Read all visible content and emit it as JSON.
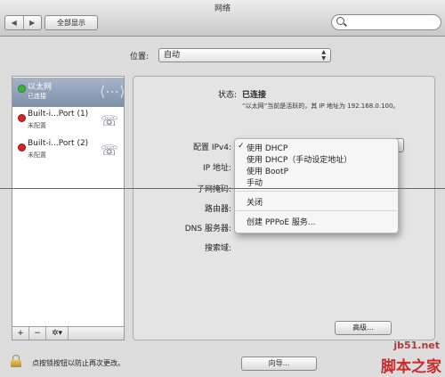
{
  "window": {
    "title": "网络"
  },
  "toolbar": {
    "back": "◀",
    "forward": "▶",
    "show_all": "全部显示",
    "search_placeholder": ""
  },
  "location": {
    "label": "位置:",
    "value": "自动"
  },
  "services": [
    {
      "name": "以太网",
      "status": "已连接",
      "status_color": "green",
      "icon": "ethernet-icon",
      "selected": true
    },
    {
      "name": "Built-i...Port (1)",
      "status": "未配置",
      "status_color": "red",
      "icon": "phone-icon",
      "selected": false
    },
    {
      "name": "Built-i...Port (2)",
      "status": "未配置",
      "status_color": "red",
      "icon": "phone-icon",
      "selected": false
    }
  ],
  "sidebar_buttons": {
    "add": "+",
    "remove": "−",
    "gear": "✲▾"
  },
  "detail": {
    "status_label": "状态:",
    "status_value": "已连接",
    "status_hint": "“以太网”当前是活跃的，其 IP 地址为 192.168.0.100。",
    "configure_ipv4_label": "配置 IPv4:",
    "ip_label": "IP 地址:",
    "subnet_label": "子网掩码:",
    "router_label": "路由器:",
    "dns_label": "DNS 服务器:",
    "search_domains_label": "搜索域:",
    "advanced_button": "高级...",
    "assist_button": "向导..."
  },
  "ipv4_menu": {
    "checkmark": "✓",
    "options": [
      "使用 DHCP",
      "使用 DHCP（手动设定地址）",
      "使用 BootP",
      "手动",
      "关闭",
      "创建 PPPoE 服务..."
    ],
    "selected_index": 0
  },
  "footer": {
    "lock_text": "点按锁按钮以防止再次更改。"
  },
  "watermark": {
    "url": "jb51.net",
    "logo": "脚本之家"
  }
}
